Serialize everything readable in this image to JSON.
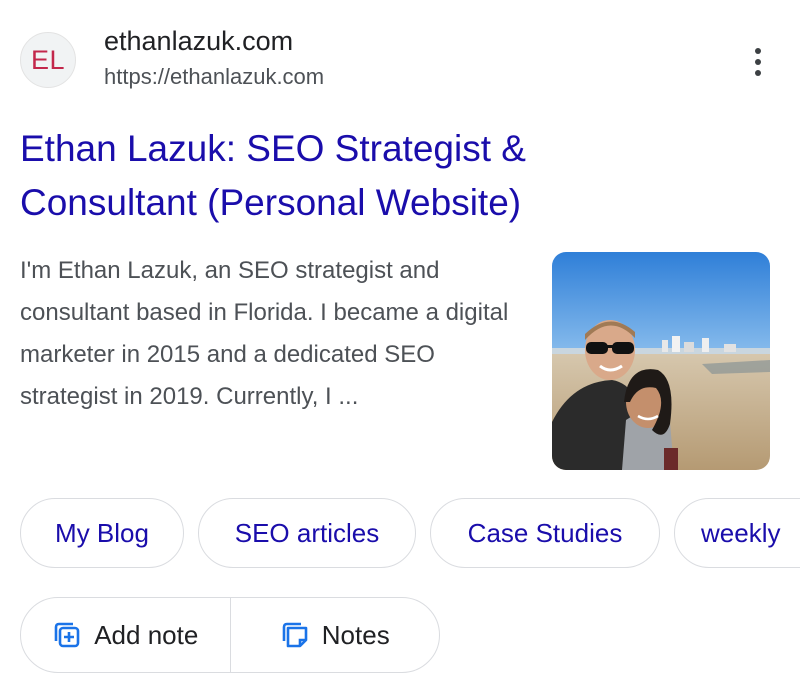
{
  "site": {
    "favicon_text": "EL",
    "name": "ethanlazuk.com",
    "url": "https://ethanlazuk.com"
  },
  "result": {
    "title": "Ethan Lazuk: SEO Strategist & Consultant (Personal Website)",
    "snippet": "I'm Ethan Lazuk, an SEO strategist and consultant based in Florida. I became a digital marketer in 2015 and a dedicated SEO strategist in 2019. Currently, I ..."
  },
  "chips": [
    "My Blog",
    "SEO articles",
    "Case Studies",
    "weekly"
  ],
  "actions": {
    "add_note": "Add note",
    "notes": "Notes"
  },
  "icons": {
    "more": "more-vert-icon",
    "add_note": "add-note-icon",
    "notes": "notes-icon"
  },
  "colors": {
    "title_link": "#1a0dab",
    "favicon_text": "#c3274b",
    "snippet": "#4d5156"
  }
}
